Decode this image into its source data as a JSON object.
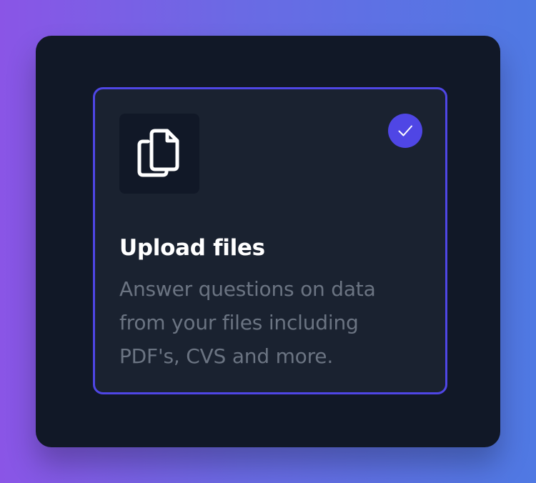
{
  "card": {
    "title": "Upload files",
    "description": "Answer questions on data from your files including PDF's, CVS and more.",
    "selected": true,
    "icon": "documents-icon"
  },
  "badge": {
    "icon": "checkmark-icon"
  },
  "colors": {
    "background_gradient_start": "#8a55e6",
    "background_gradient_end": "#4f79e3",
    "panel": "#111827",
    "card": "#1a2230",
    "accent": "#4f46e5",
    "title_text": "#ffffff",
    "description_text": "#6b7482"
  }
}
